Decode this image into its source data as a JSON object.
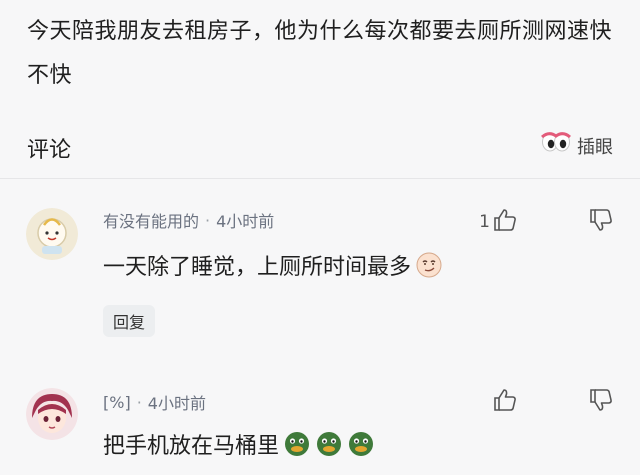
{
  "post": {
    "text": "今天陪我朋友去租房子，他为什么每次都要去厕所测网速快不快"
  },
  "comments_header": {
    "title": "评论",
    "peek_label": "插眼",
    "peek_icon": "peeking-eyes-icon"
  },
  "comments": [
    {
      "username": "有没有能用的",
      "separator": "·",
      "time": "4小时前",
      "text": "一天除了睡觉，上厕所时间最多",
      "emojis": [
        "smirk-face-emoji"
      ],
      "likes": "1",
      "reply_label": "回复"
    },
    {
      "username": "[%]",
      "separator": "·",
      "time": "4小时前",
      "text": "把手机放在马桶里",
      "emojis": [
        "green-duck-emoji",
        "green-duck-emoji",
        "green-duck-emoji"
      ],
      "likes": ""
    }
  ],
  "colors": {
    "background": "#f7f7f8",
    "meta_text": "#6b7280",
    "reply_bg": "#eceef0"
  }
}
